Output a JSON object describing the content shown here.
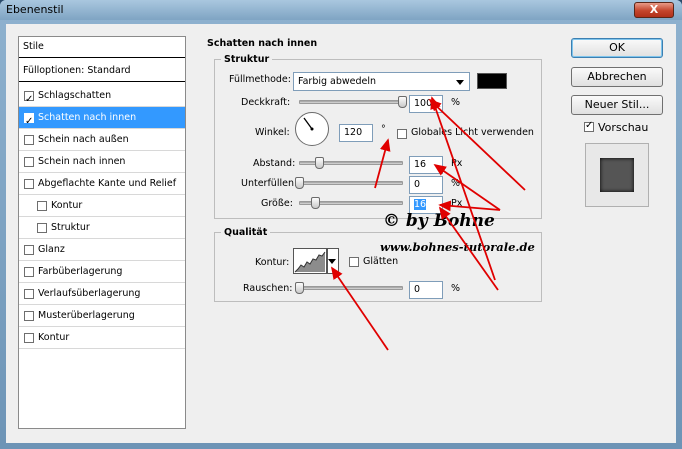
{
  "window": {
    "title": "Ebenenstil",
    "close_label": "X"
  },
  "stylelist": {
    "header": "Stile",
    "blend_options": "Fülloptionen: Standard",
    "items": [
      {
        "label": "Schlagschatten",
        "checked": true
      },
      {
        "label": "Schatten nach innen",
        "checked": true,
        "active": true
      },
      {
        "label": "Schein nach außen",
        "checked": false
      },
      {
        "label": "Schein nach innen",
        "checked": false
      },
      {
        "label": "Abgeflachte Kante und Relief",
        "checked": false
      },
      {
        "label": "Kontur",
        "checked": false
      },
      {
        "label": "Struktur",
        "checked": false
      },
      {
        "label": "Glanz",
        "checked": false
      },
      {
        "label": "Farbüberlagerung",
        "checked": false
      },
      {
        "label": "Verlaufsüberlagerung",
        "checked": false
      },
      {
        "label": "Musterüberlagerung",
        "checked": false
      },
      {
        "label": "Kontur",
        "checked": false
      }
    ]
  },
  "panel": {
    "title": "Schatten nach innen",
    "struktur": {
      "title": "Struktur",
      "fill_label": "Füllmethode:",
      "fill_value": "Farbig abwedeln",
      "opacity_label": "Deckkraft:",
      "opacity_value": "100",
      "opacity_unit": "%",
      "angle_label": "Winkel:",
      "angle_value": "120",
      "angle_unit": "°",
      "global_light_label": "Globales Licht verwenden",
      "distance_label": "Abstand:",
      "distance_value": "16",
      "distance_unit": "Px",
      "choke_label": "Unterfüllen:",
      "choke_value": "0",
      "choke_unit": "%",
      "size_label": "Größe:",
      "size_value": "16",
      "size_unit": "Px",
      "swatch_color": "#000000"
    },
    "qualitaet": {
      "title": "Qualität",
      "contour_label": "Kontur:",
      "smooth_label": "Glätten",
      "noise_label": "Rauschen:",
      "noise_value": "0",
      "noise_unit": "%"
    }
  },
  "buttons": {
    "ok": "OK",
    "cancel": "Abbrechen",
    "new_style": "Neuer Stil...",
    "preview_label": "Vorschau"
  },
  "watermark": {
    "line1": "© by Bohne",
    "line2": "www.bohnes-tutorale.de"
  }
}
